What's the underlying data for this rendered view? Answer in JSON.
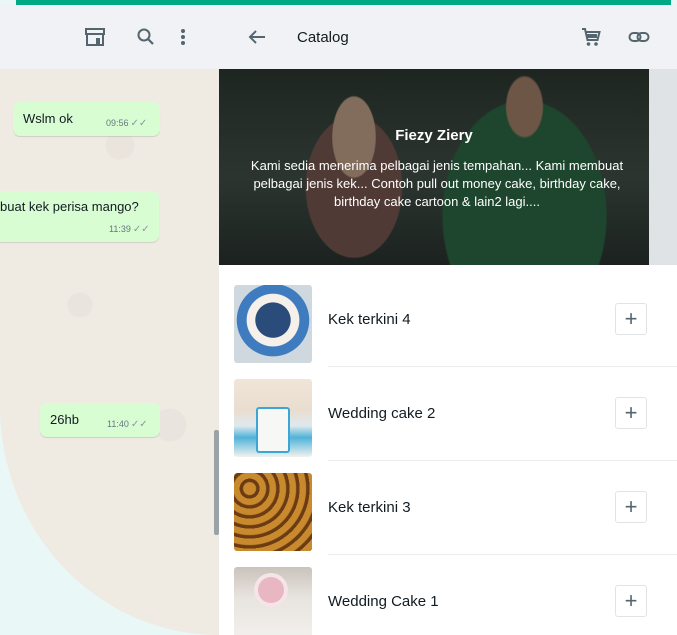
{
  "chat": {
    "messages": [
      {
        "text": "Wslm ok",
        "time": "09:56"
      },
      {
        "text": "buat kek perisa mango?",
        "time": "11:39"
      },
      {
        "text": "26hb",
        "time": "11:40"
      }
    ]
  },
  "catalog": {
    "title": "Catalog",
    "business_name": "Fiezy Ziery",
    "description": "Kami sedia menerima pelbagai jenis tempahan... Kami membuat pelbagai jenis kek... Contoh pull out money cake, birthday cake, birthday cake cartoon & lain2 lagi....",
    "products": [
      {
        "name": "Kek terkini 4",
        "add_label": "+"
      },
      {
        "name": "Wedding cake 2",
        "add_label": "+"
      },
      {
        "name": "Kek terkini 3",
        "add_label": "+"
      },
      {
        "name": "Wedding Cake 1",
        "add_label": "+"
      }
    ]
  },
  "colors": {
    "accent": "#00a884",
    "bubble": "#d9fdd3",
    "chat_bg": "#efeae2",
    "header_bg": "#f0f2f5"
  },
  "icons": [
    "shop-icon",
    "search-icon",
    "menu-icon",
    "back-arrow-icon",
    "cart-icon",
    "link-icon",
    "double-check-icon",
    "plus-icon"
  ]
}
